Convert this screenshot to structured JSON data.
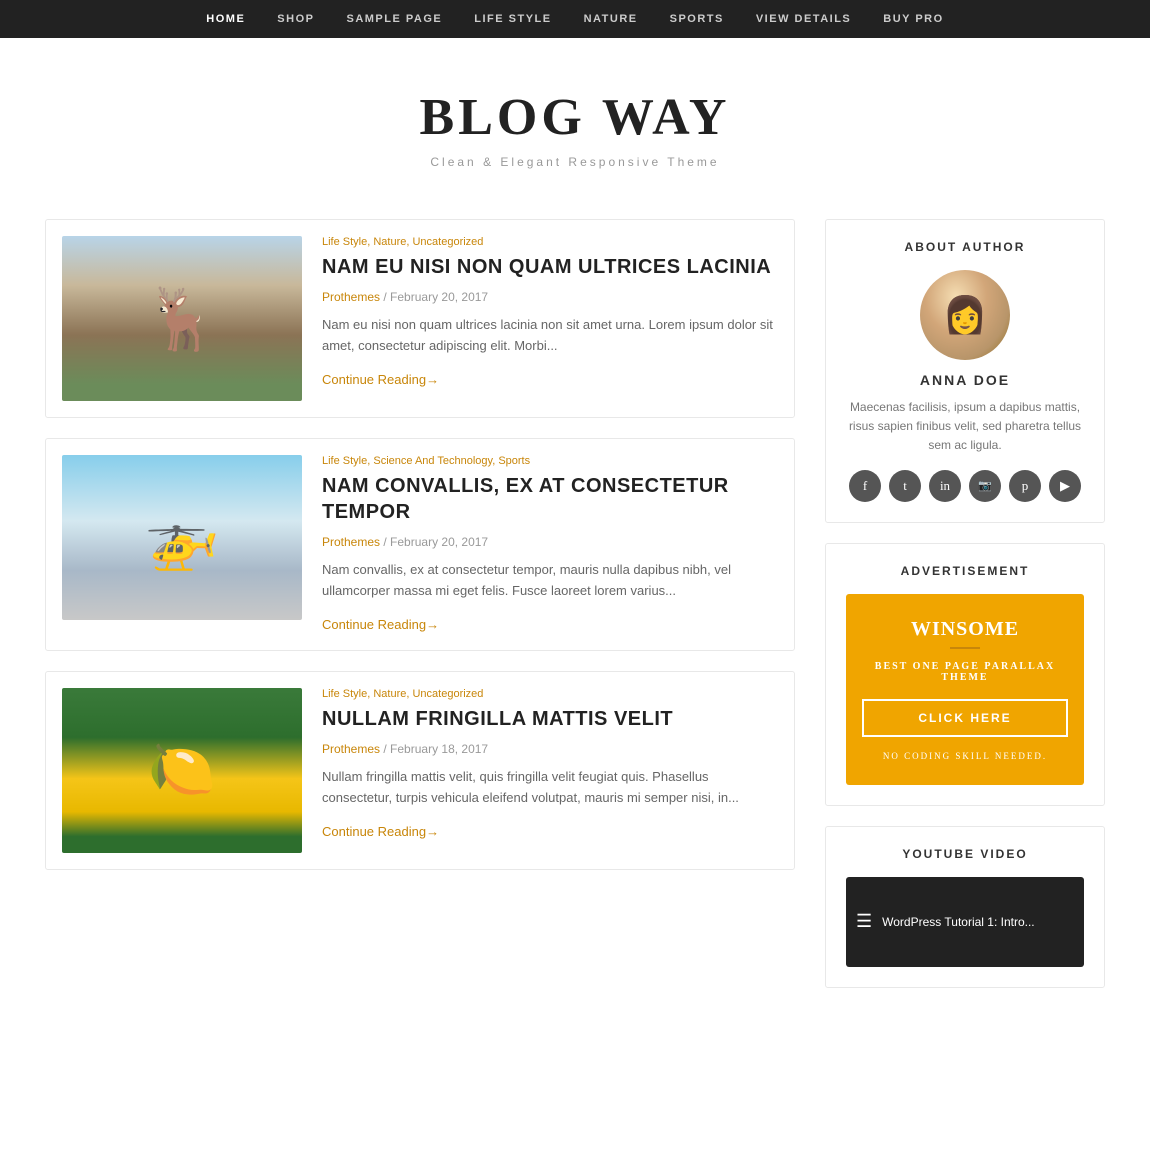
{
  "nav": {
    "items": [
      {
        "label": "HOME",
        "active": true
      },
      {
        "label": "SHOP",
        "active": false
      },
      {
        "label": "SAMPLE PAGE",
        "active": false
      },
      {
        "label": "LIFE STYLE",
        "active": false
      },
      {
        "label": "NATURE",
        "active": false
      },
      {
        "label": "SPORTS",
        "active": false
      },
      {
        "label": "VIEW DETAILS",
        "active": false
      },
      {
        "label": "BUY PRO",
        "active": false
      }
    ]
  },
  "header": {
    "title": "BLOG WAY",
    "subtitle": "Clean & Elegant Responsive Theme"
  },
  "articles": [
    {
      "id": 1,
      "imageType": "deer",
      "categories": "Life Style, Nature, Uncategorized",
      "title": "NAM EU NISI NON QUAM ULTRICES LACINIA",
      "author": "Prothemes",
      "date": "February 20, 2017",
      "excerpt": "Nam eu nisi non quam ultrices lacinia non sit amet urna. Lorem ipsum dolor sit amet, consectetur adipiscing elit. Morbi...",
      "continue": "Continue Reading→"
    },
    {
      "id": 2,
      "imageType": "drone",
      "categories": "Life Style, Science And Technology, Sports",
      "title": "NAM CONVALLIS, EX AT CONSECTETUR TEMPOR",
      "author": "Prothemes",
      "date": "February 20, 2017",
      "excerpt": "Nam convallis, ex at consectetur tempor, mauris nulla dapibus nibh, vel ullamcorper massa mi eget felis. Fusce laoreet lorem varius...",
      "continue": "Continue Reading→"
    },
    {
      "id": 3,
      "imageType": "lemon",
      "categories": "Life Style, Nature, Uncategorized",
      "title": "NULLAM FRINGILLA MATTIS VELIT",
      "author": "Prothemes",
      "date": "February 18, 2017",
      "excerpt": "Nullam fringilla mattis velit, quis fringilla velit feugiat quis. Phasellus consectetur, turpis vehicula eleifend volutpat, mauris mi semper nisi, in...",
      "continue": "Continue Reading→"
    }
  ],
  "sidebar": {
    "about": {
      "title": "ABOUT AUTHOR",
      "authorName": "ANNA DOE",
      "bio": "Maecenas facilisis, ipsum a dapibus mattis, risus sapien finibus velit, sed pharetra tellus sem ac ligula.",
      "socialIcons": [
        {
          "name": "facebook",
          "symbol": "f"
        },
        {
          "name": "twitter",
          "symbol": "t"
        },
        {
          "name": "linkedin",
          "symbol": "in"
        },
        {
          "name": "instagram",
          "symbol": "📷"
        },
        {
          "name": "pinterest",
          "symbol": "p"
        },
        {
          "name": "youtube",
          "symbol": "▶"
        }
      ]
    },
    "advertisement": {
      "title": "ADVERTISEMENT",
      "adTitle": "WINSOME",
      "adSubtitle": "BEST ONE PAGE PARALLAX THEME",
      "buttonLabel": "CLICK HERE",
      "footer": "NO CODING SKILL NEEDED."
    },
    "youtube": {
      "title": "YOUTUBE VIDEO",
      "videoTitle": "WordPress Tutorial 1: Intro..."
    }
  }
}
